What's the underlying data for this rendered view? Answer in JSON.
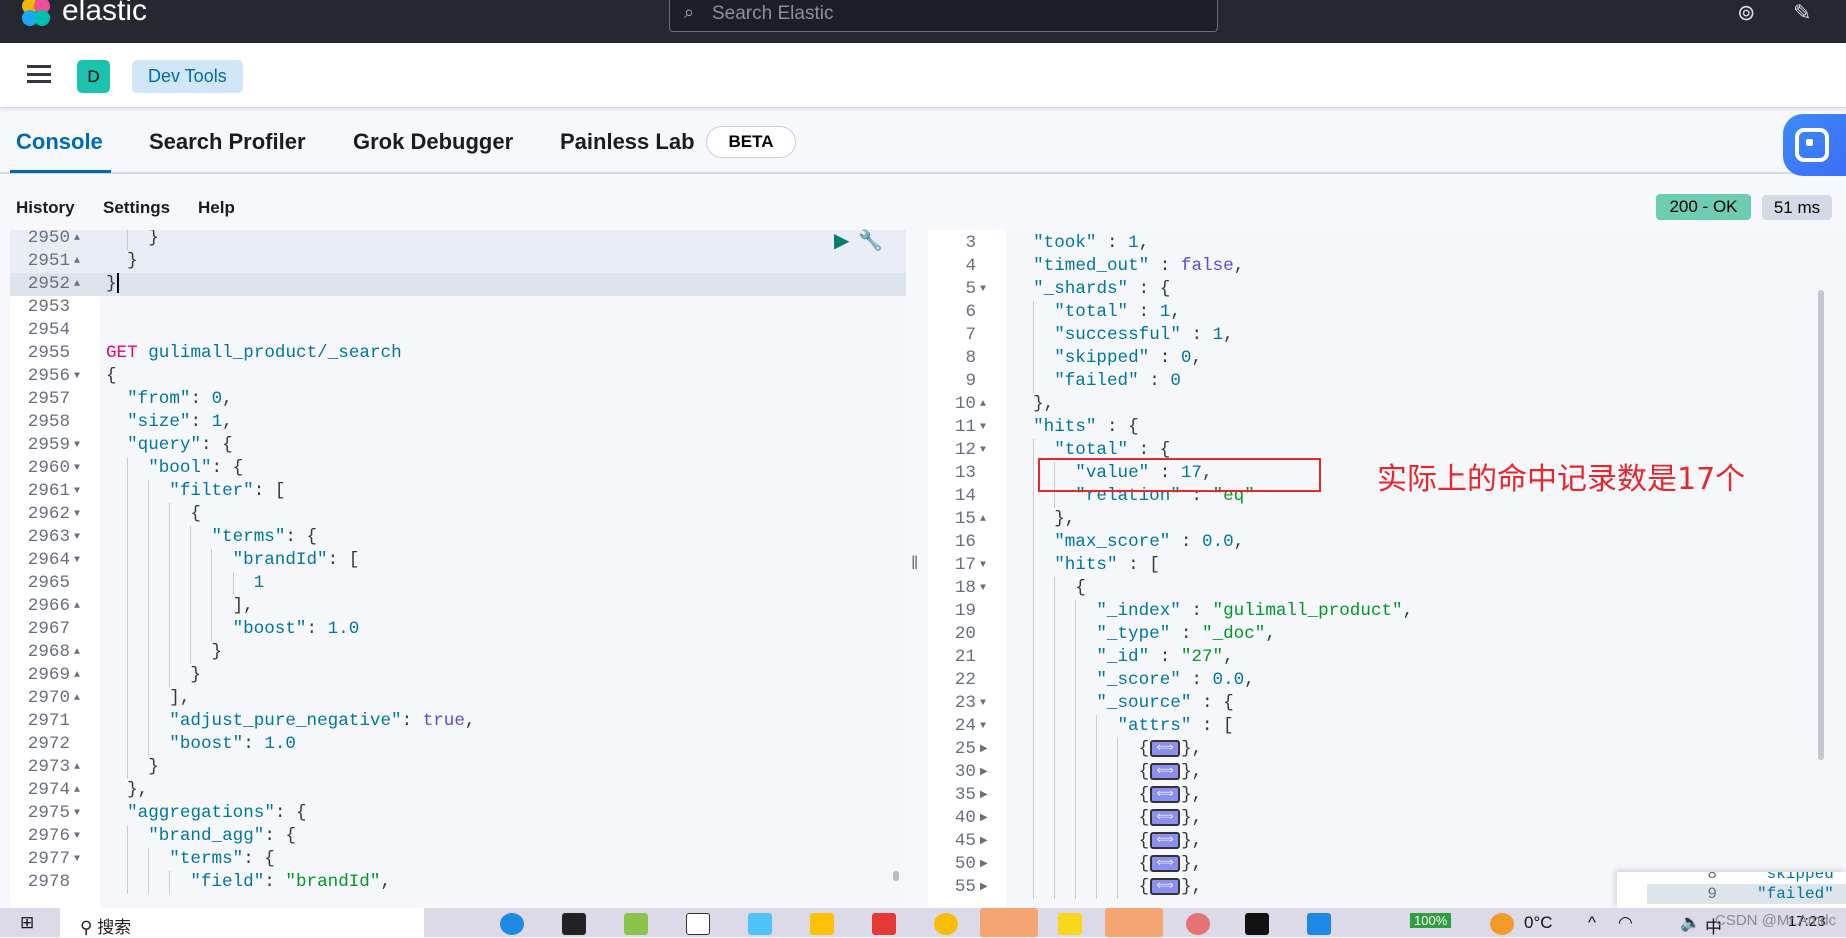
{
  "topbar": {
    "logo_text": "elastic",
    "search_placeholder": "Search Elastic"
  },
  "header": {
    "space_initial": "D",
    "breadcrumb": "Dev Tools"
  },
  "tabs": [
    {
      "label": "Console",
      "active": true
    },
    {
      "label": "Search Profiler",
      "active": false
    },
    {
      "label": "Grok Debugger",
      "active": false
    },
    {
      "label": "Painless Lab",
      "active": false
    }
  ],
  "beta_badge": "BETA",
  "toolbar": {
    "history": "History",
    "settings": "Settings",
    "help": "Help"
  },
  "response_status": {
    "status": "200 - OK",
    "time": "51 ms",
    "status_color": "#6dccb1"
  },
  "request_editor": {
    "lines": [
      {
        "n": "2950",
        "fold": "up",
        "indent": 2,
        "tokens": [
          [
            "p",
            "}"
          ]
        ],
        "hl": "a"
      },
      {
        "n": "2951",
        "fold": "up",
        "indent": 1,
        "tokens": [
          [
            "p",
            "}"
          ]
        ],
        "hl": "a"
      },
      {
        "n": "2952",
        "fold": "up",
        "indent": 0,
        "tokens": [
          [
            "p",
            "}"
          ]
        ],
        "hl": "h",
        "cursor": true
      },
      {
        "n": "2953",
        "indent": 0,
        "tokens": []
      },
      {
        "n": "2954",
        "indent": 0,
        "tokens": []
      },
      {
        "n": "2955",
        "indent": 0,
        "tokens": [
          [
            "m",
            "GET "
          ],
          [
            "u",
            "gulimall_product/_search"
          ]
        ]
      },
      {
        "n": "2956",
        "fold": "down",
        "indent": 0,
        "tokens": [
          [
            "p",
            "{"
          ]
        ]
      },
      {
        "n": "2957",
        "indent": 1,
        "tokens": [
          [
            "k",
            "\"from\""
          ],
          [
            "p",
            ": "
          ],
          [
            "n",
            "0"
          ],
          [
            "p",
            ","
          ]
        ]
      },
      {
        "n": "2958",
        "indent": 1,
        "tokens": [
          [
            "k",
            "\"size\""
          ],
          [
            "p",
            ": "
          ],
          [
            "n",
            "1"
          ],
          [
            "p",
            ","
          ]
        ]
      },
      {
        "n": "2959",
        "fold": "down",
        "indent": 1,
        "tokens": [
          [
            "k",
            "\"query\""
          ],
          [
            "p",
            ": {"
          ]
        ]
      },
      {
        "n": "2960",
        "fold": "down",
        "indent": 2,
        "tokens": [
          [
            "k",
            "\"bool\""
          ],
          [
            "p",
            ": {"
          ]
        ]
      },
      {
        "n": "2961",
        "fold": "down",
        "indent": 3,
        "tokens": [
          [
            "k",
            "\"filter\""
          ],
          [
            "p",
            ": ["
          ]
        ]
      },
      {
        "n": "2962",
        "fold": "down",
        "indent": 4,
        "tokens": [
          [
            "p",
            "{"
          ]
        ]
      },
      {
        "n": "2963",
        "fold": "down",
        "indent": 5,
        "tokens": [
          [
            "k",
            "\"terms\""
          ],
          [
            "p",
            ": {"
          ]
        ]
      },
      {
        "n": "2964",
        "fold": "down",
        "indent": 6,
        "tokens": [
          [
            "k",
            "\"brandId\""
          ],
          [
            "p",
            ": ["
          ]
        ]
      },
      {
        "n": "2965",
        "indent": 7,
        "tokens": [
          [
            "n",
            "1"
          ]
        ]
      },
      {
        "n": "2966",
        "fold": "up",
        "indent": 6,
        "tokens": [
          [
            "p",
            "],"
          ]
        ]
      },
      {
        "n": "2967",
        "indent": 6,
        "tokens": [
          [
            "k",
            "\"boost\""
          ],
          [
            "p",
            ": "
          ],
          [
            "n",
            "1.0"
          ]
        ]
      },
      {
        "n": "2968",
        "fold": "up",
        "indent": 5,
        "tokens": [
          [
            "p",
            "}"
          ]
        ]
      },
      {
        "n": "2969",
        "fold": "up",
        "indent": 4,
        "tokens": [
          [
            "p",
            "}"
          ]
        ]
      },
      {
        "n": "2970",
        "fold": "up",
        "indent": 3,
        "tokens": [
          [
            "p",
            "],"
          ]
        ]
      },
      {
        "n": "2971",
        "indent": 3,
        "tokens": [
          [
            "k",
            "\"adjust_pure_negative\""
          ],
          [
            "p",
            ": "
          ],
          [
            "b",
            "true"
          ],
          [
            "p",
            ","
          ]
        ]
      },
      {
        "n": "2972",
        "indent": 3,
        "tokens": [
          [
            "k",
            "\"boost\""
          ],
          [
            "p",
            ": "
          ],
          [
            "n",
            "1.0"
          ]
        ]
      },
      {
        "n": "2973",
        "fold": "up",
        "indent": 2,
        "tokens": [
          [
            "p",
            "}"
          ]
        ]
      },
      {
        "n": "2974",
        "fold": "up",
        "indent": 1,
        "tokens": [
          [
            "p",
            "},"
          ]
        ]
      },
      {
        "n": "2975",
        "fold": "down",
        "indent": 1,
        "tokens": [
          [
            "k",
            "\"aggregations\""
          ],
          [
            "p",
            ": {"
          ]
        ]
      },
      {
        "n": "2976",
        "fold": "down",
        "indent": 2,
        "tokens": [
          [
            "k",
            "\"brand_agg\""
          ],
          [
            "p",
            ": {"
          ]
        ]
      },
      {
        "n": "2977",
        "fold": "down",
        "indent": 3,
        "tokens": [
          [
            "k",
            "\"terms\""
          ],
          [
            "p",
            ": {"
          ]
        ]
      },
      {
        "n": "2978",
        "indent": 4,
        "tokens": [
          [
            "k",
            "\"field\""
          ],
          [
            "p",
            ": "
          ],
          [
            "s",
            "\"brandId\""
          ],
          [
            "p",
            ","
          ]
        ]
      }
    ]
  },
  "response_editor": {
    "lines": [
      {
        "n": "3",
        "indent": 1,
        "tokens": [
          [
            "k",
            "\"took\""
          ],
          [
            "p",
            " : "
          ],
          [
            "n",
            "1"
          ],
          [
            "p",
            ","
          ]
        ]
      },
      {
        "n": "4",
        "indent": 1,
        "tokens": [
          [
            "k",
            "\"timed_out\""
          ],
          [
            "p",
            " : "
          ],
          [
            "b",
            "false"
          ],
          [
            "p",
            ","
          ]
        ]
      },
      {
        "n": "5",
        "fold": "down",
        "indent": 1,
        "tokens": [
          [
            "k",
            "\"_shards\""
          ],
          [
            "p",
            " : {"
          ]
        ]
      },
      {
        "n": "6",
        "indent": 2,
        "tokens": [
          [
            "k",
            "\"total\""
          ],
          [
            "p",
            " : "
          ],
          [
            "n",
            "1"
          ],
          [
            "p",
            ","
          ]
        ]
      },
      {
        "n": "7",
        "indent": 2,
        "tokens": [
          [
            "k",
            "\"successful\""
          ],
          [
            "p",
            " : "
          ],
          [
            "n",
            "1"
          ],
          [
            "p",
            ","
          ]
        ]
      },
      {
        "n": "8",
        "indent": 2,
        "tokens": [
          [
            "k",
            "\"skipped\""
          ],
          [
            "p",
            " : "
          ],
          [
            "n",
            "0"
          ],
          [
            "p",
            ","
          ]
        ]
      },
      {
        "n": "9",
        "indent": 2,
        "tokens": [
          [
            "k",
            "\"failed\""
          ],
          [
            "p",
            " : "
          ],
          [
            "n",
            "0"
          ]
        ]
      },
      {
        "n": "10",
        "fold": "up",
        "indent": 1,
        "tokens": [
          [
            "p",
            "},"
          ]
        ]
      },
      {
        "n": "11",
        "fold": "down",
        "indent": 1,
        "tokens": [
          [
            "k",
            "\"hits\""
          ],
          [
            "p",
            " : {"
          ]
        ]
      },
      {
        "n": "12",
        "fold": "down",
        "indent": 2,
        "tokens": [
          [
            "k",
            "\"total\""
          ],
          [
            "p",
            " : {"
          ]
        ]
      },
      {
        "n": "13",
        "indent": 3,
        "tokens": [
          [
            "k",
            "\"value\""
          ],
          [
            "p",
            " : "
          ],
          [
            "n",
            "17"
          ],
          [
            "p",
            ","
          ]
        ]
      },
      {
        "n": "14",
        "indent": 3,
        "tokens": [
          [
            "k",
            "\"relation\""
          ],
          [
            "p",
            " : "
          ],
          [
            "s",
            "\"eq\""
          ]
        ]
      },
      {
        "n": "15",
        "fold": "up",
        "indent": 2,
        "tokens": [
          [
            "p",
            "},"
          ]
        ]
      },
      {
        "n": "16",
        "indent": 2,
        "tokens": [
          [
            "k",
            "\"max_score\""
          ],
          [
            "p",
            " : "
          ],
          [
            "n",
            "0.0"
          ],
          [
            "p",
            ","
          ]
        ]
      },
      {
        "n": "17",
        "fold": "down",
        "indent": 2,
        "tokens": [
          [
            "k",
            "\"hits\""
          ],
          [
            "p",
            " : ["
          ]
        ]
      },
      {
        "n": "18",
        "fold": "down",
        "indent": 3,
        "tokens": [
          [
            "p",
            "{"
          ]
        ]
      },
      {
        "n": "19",
        "indent": 4,
        "tokens": [
          [
            "k",
            "\"_index\""
          ],
          [
            "p",
            " : "
          ],
          [
            "s",
            "\"gulimall_product\""
          ],
          [
            "p",
            ","
          ]
        ]
      },
      {
        "n": "20",
        "indent": 4,
        "tokens": [
          [
            "k",
            "\"_type\""
          ],
          [
            "p",
            " : "
          ],
          [
            "s",
            "\"_doc\""
          ],
          [
            "p",
            ","
          ]
        ]
      },
      {
        "n": "21",
        "indent": 4,
        "tokens": [
          [
            "k",
            "\"_id\""
          ],
          [
            "p",
            " : "
          ],
          [
            "s",
            "\"27\""
          ],
          [
            "p",
            ","
          ]
        ]
      },
      {
        "n": "22",
        "indent": 4,
        "tokens": [
          [
            "k",
            "\"_score\""
          ],
          [
            "p",
            " : "
          ],
          [
            "n",
            "0.0"
          ],
          [
            "p",
            ","
          ]
        ]
      },
      {
        "n": "23",
        "fold": "down",
        "indent": 4,
        "tokens": [
          [
            "k",
            "\"_source\""
          ],
          [
            "p",
            " : {"
          ]
        ]
      },
      {
        "n": "24",
        "fold": "down",
        "indent": 5,
        "tokens": [
          [
            "k",
            "\"attrs\""
          ],
          [
            "p",
            " : ["
          ]
        ]
      },
      {
        "n": "25",
        "fold": "right",
        "indent": 6,
        "folded": true
      },
      {
        "n": "30",
        "fold": "right",
        "indent": 6,
        "folded": true
      },
      {
        "n": "35",
        "fold": "right",
        "indent": 6,
        "folded": true
      },
      {
        "n": "40",
        "fold": "right",
        "indent": 6,
        "folded": true
      },
      {
        "n": "45",
        "fold": "right",
        "indent": 6,
        "folded": true
      },
      {
        "n": "50",
        "fold": "right",
        "indent": 6,
        "folded": true
      },
      {
        "n": "55",
        "fold": "right",
        "indent": 6,
        "folded": true
      }
    ]
  },
  "annotation": "实际上的命中记录数是17个",
  "popup": {
    "lines": [
      {
        "n": "8",
        "text": "\"skipped\""
      },
      {
        "n": "9",
        "text": "\"failed\""
      }
    ]
  },
  "taskbar": {
    "search": "搜索",
    "battery": "100%",
    "weather": "0°C",
    "ime": "中",
    "clock": "17:23"
  },
  "watermark": "CSDN @Mr.Amdc"
}
